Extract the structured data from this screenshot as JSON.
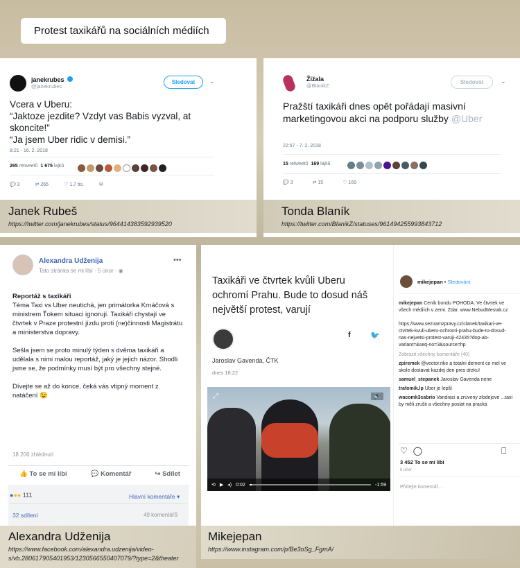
{
  "title": "Protest taxikářů na sociálních médiích",
  "card1": {
    "name": "janekrubes",
    "handle": "@janekrubes",
    "follow": "Sledovat",
    "text": [
      "Vcera v Uberu:",
      "“Jaktoze jezdite? Vzdyt vas Babis vyzval, at skoncite!”",
      "“Ja jsem Uber ridic v demisi.”"
    ],
    "time": "8:21 - 16. 2. 2018",
    "retweets_num": "265",
    "retweets_lbl": "retweetů",
    "likes_num": "1 675",
    "likes_lbl": "lajků",
    "reply": "3",
    "rt": "265",
    "like": "1,7 tis."
  },
  "caption1": {
    "name": "Janek Rubeš",
    "url": "https://twitter.com/janekrubes/status/964414383592939520"
  },
  "card2": {
    "name": "Žížala",
    "handle": "@BlanikZ",
    "follow": "Sledovat",
    "text": "Pražští taxikáři dnes opět pořádají masivní marketingovou akci na podporu služby ",
    "mention": "@Uber",
    "time": "22:57 - 7. 2. 2018",
    "retweets_num": "15",
    "retweets_lbl": "retweetů",
    "likes_num": "169",
    "likes_lbl": "lajků",
    "reply": "3",
    "rt": "15",
    "like": "169"
  },
  "caption2": {
    "name": "Tonda Blaník",
    "url": "https://twitter.com/BlanikZ/statuses/961494255993843712"
  },
  "card3": {
    "name": "Alexandra Udženija",
    "meta": "Tato stránka se mi líbí · 5 únor · ",
    "heading": "Reportáž s taxikáři",
    "p1": "Téma Taxi vs Uber neutichá, jen primátorka Krnáčová s ministrem Ťokem situaci ignorují. Taxikáři chystají ve čtvrtek v Praze protestní jízdu proti (ne)činnosti Magistrátu a ministerstva dopravy.",
    "p2": "Sešla jsem se proto minulý týden s dvěma taxikáři a udělala s nimi malou reportáž, jaký je jejich názor. Shodli jsme se, že podmínky musí být pro všechny stejné.",
    "p3": "Dívejte se až do konce, čeká vás vtipný moment z natáčení 😉",
    "views": "18 206 zhlédnutí",
    "like": "To se mi líbí",
    "comment": "Komentář",
    "share": "Sdílet",
    "reactions": "111",
    "sort": "Hlavní komentáře ▾",
    "shares": "32 sdílení",
    "comments": "49 komentářů"
  },
  "caption3": {
    "name": "Alexandra Udženija",
    "url1": "https://www.facebook.com/alexandra.udzenija/video-",
    "url2": "s/vb.280617905401953/1230566550407079/?type=2&theater"
  },
  "card4": {
    "headline": "Taxikáři ve čtvrtek kvůli Uberu ochromí Prahu. Bude to dosud náš největší protest, varují",
    "author": "Jaroslav Gavenda, ČTK",
    "date": "dnes 18:22",
    "time_cur": "0:02",
    "time_left": "-1:59",
    "ig_user": "mikejepan",
    "ig_follow": "Sledování",
    "comments": [
      {
        "u": "mikejepan",
        "t": "Ceník bundu POHODA. Ve čtvrtek ve všech médiích v zemi. Zdar. www.NebudMestak.cz"
      },
      {
        "u": "",
        "t": "https://www.seznamzpravy.cz/clanek/taxikari-ve-ctvrtek-kvuli-uberu-ochromi-prahu-bude-to-dosud-nas-nejvetsi-protest-varuji-42435?dop-ab-variant=&seq-no=3&source=hp"
      },
      {
        "u": "",
        "t": "Zobrazit všechny komentáře (40)"
      },
      {
        "u": "zpiremek",
        "t": "@vector.rike a totalni dement co mel ve skole dostavat kazdej den pres drzku!"
      },
      {
        "u": "samuel_stepanek",
        "t": "Jaroslav Gavenda nene"
      },
      {
        "u": "tratomik.lp",
        "t": "Uber je lepší"
      },
      {
        "u": "wacomk3cabrio",
        "t": "Vandraci a zruveny zlodejove ...taxi by měli zrušit a všechny poslat na pracka"
      }
    ],
    "likes": "3 452 To se mi líbí",
    "ago": "6 únor",
    "add_comment": "Přidejte komentář..."
  },
  "caption4": {
    "name": "Mikejepan",
    "url": "https://www.instagram.com/p/Be3oSg_FgmA/"
  },
  "colors": {
    "twitter": "#1da1f2",
    "facebook": "#4267b2"
  }
}
